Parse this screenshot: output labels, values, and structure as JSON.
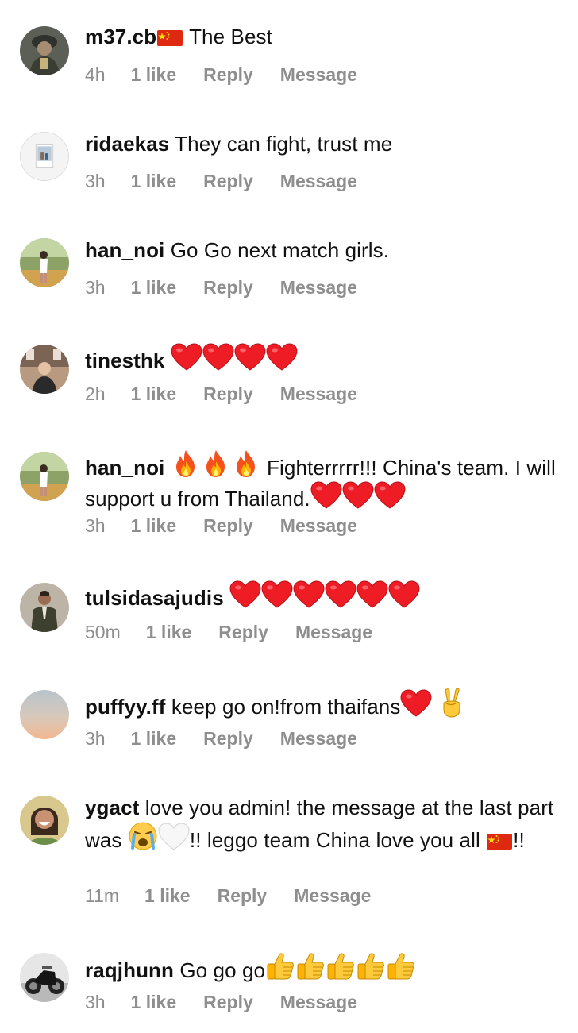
{
  "comments": [
    {
      "username": "m37.cb",
      "segments": [
        {
          "t": "emoji",
          "v": "flag-china"
        },
        {
          "t": "text",
          "v": " The Best"
        }
      ],
      "time": "4h",
      "likes": "1 like",
      "reply": "Reply",
      "message": "Message",
      "avatar": "avatar-dark-figure"
    },
    {
      "username": "ridaekas",
      "segments": [
        {
          "t": "text",
          "v": " They can fight, trust me"
        }
      ],
      "time": "3h",
      "likes": "1 like",
      "reply": "Reply",
      "message": "Message",
      "avatar": "avatar-polaroid"
    },
    {
      "username": "han_noi",
      "segments": [
        {
          "t": "text",
          "v": " Go Go next match girls."
        }
      ],
      "time": "3h",
      "likes": "1 like",
      "reply": "Reply",
      "message": "Message",
      "avatar": "avatar-outdoor-person"
    },
    {
      "username": "tinesthk",
      "segments": [
        {
          "t": "text",
          "v": " "
        },
        {
          "t": "emoji",
          "v": "red-heart"
        },
        {
          "t": "emoji",
          "v": "red-heart"
        },
        {
          "t": "emoji",
          "v": "red-heart"
        },
        {
          "t": "emoji",
          "v": "red-heart"
        }
      ],
      "time": "2h",
      "likes": "1 like",
      "reply": "Reply",
      "message": "Message",
      "avatar": "avatar-indoor-person"
    },
    {
      "username": "han_noi",
      "segments": [
        {
          "t": "text",
          "v": " "
        },
        {
          "t": "emoji",
          "v": "fire"
        },
        {
          "t": "emoji",
          "v": "fire"
        },
        {
          "t": "emoji",
          "v": "fire"
        },
        {
          "t": "text",
          "v": " Fighterrrrr!!! China's team. I will support u from Thailand."
        },
        {
          "t": "emoji",
          "v": "red-heart"
        },
        {
          "t": "emoji",
          "v": "red-heart"
        },
        {
          "t": "emoji",
          "v": "red-heart"
        }
      ],
      "time": "3h",
      "likes": "1 like",
      "reply": "Reply",
      "message": "Message",
      "avatar": "avatar-outdoor-person"
    },
    {
      "username": "tulsidasajudis",
      "segments": [
        {
          "t": "text",
          "v": " "
        },
        {
          "t": "emoji",
          "v": "red-heart"
        },
        {
          "t": "emoji",
          "v": "red-heart"
        },
        {
          "t": "emoji",
          "v": "red-heart"
        },
        {
          "t": "emoji",
          "v": "red-heart"
        },
        {
          "t": "emoji",
          "v": "red-heart"
        },
        {
          "t": "emoji",
          "v": "red-heart"
        }
      ],
      "time": "50m",
      "likes": "1 like",
      "reply": "Reply",
      "message": "Message",
      "avatar": "avatar-suited-man"
    },
    {
      "username": "puffyy.ff",
      "segments": [
        {
          "t": "text",
          "v": " keep go on!from thaifans"
        },
        {
          "t": "emoji",
          "v": "red-heart"
        },
        {
          "t": "text",
          "v": " "
        },
        {
          "t": "emoji",
          "v": "victory-hand"
        }
      ],
      "time": "3h",
      "likes": "1 like",
      "reply": "Reply",
      "message": "Message",
      "avatar": "avatar-sunset-gradient"
    },
    {
      "username": "ygact",
      "segments": [
        {
          "t": "text",
          "v": " love you admin! the message at the last part was "
        },
        {
          "t": "emoji",
          "v": "crying-face"
        },
        {
          "t": "emoji",
          "v": "white-heart"
        },
        {
          "t": "text",
          "v": "!! leggo team China love you all "
        },
        {
          "t": "emoji",
          "v": "flag-china"
        },
        {
          "t": "text",
          "v": "!!"
        }
      ],
      "time": "11m",
      "likes": "1 like",
      "reply": "Reply",
      "message": "Message",
      "avatar": "avatar-smiling-woman"
    },
    {
      "username": "raqjhunn",
      "segments": [
        {
          "t": "text",
          "v": " Go go go"
        },
        {
          "t": "emoji",
          "v": "thumbs-up"
        },
        {
          "t": "emoji",
          "v": "thumbs-up"
        },
        {
          "t": "emoji",
          "v": "thumbs-up"
        },
        {
          "t": "emoji",
          "v": "thumbs-up"
        },
        {
          "t": "emoji",
          "v": "thumbs-up"
        }
      ],
      "time": "3h",
      "likes": "1 like",
      "reply": "Reply",
      "message": "Message",
      "avatar": "avatar-motorcycle"
    }
  ],
  "colors": {
    "text": "#111111",
    "meta": "#8e8e8e",
    "heart": "#ee1c25",
    "flag_red": "#de2910",
    "flag_star": "#ffde00"
  }
}
